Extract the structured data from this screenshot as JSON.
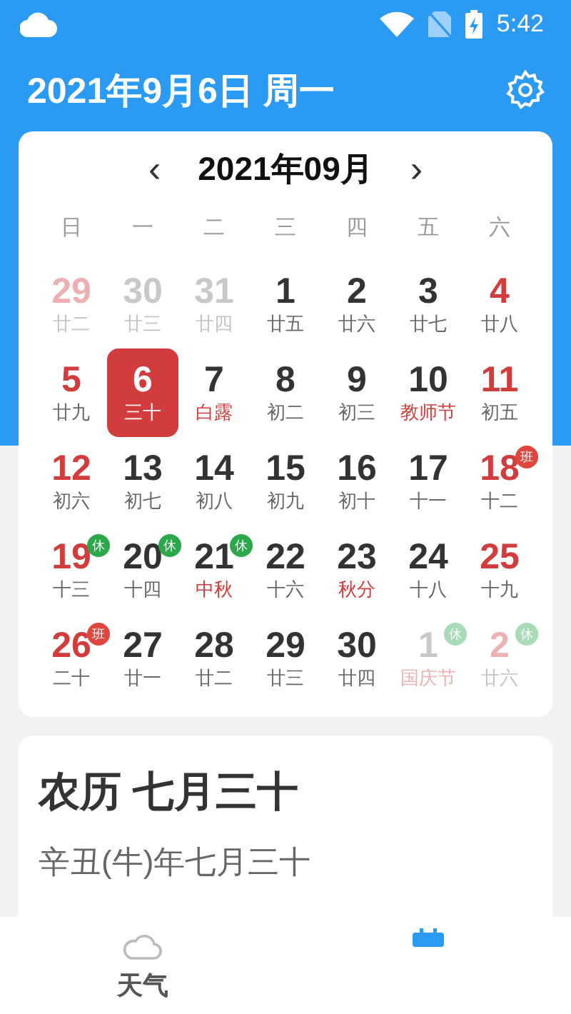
{
  "status_bar": {
    "time": "5:42"
  },
  "header": {
    "title": "2021年9月6日 周一"
  },
  "calendar": {
    "month": "2021年09月",
    "prev": "‹",
    "next": "›",
    "weekdays": [
      "日",
      "一",
      "二",
      "三",
      "四",
      "五",
      "六"
    ],
    "days": [
      {
        "day": "29",
        "lunar": "廿二",
        "muted": true,
        "weekend": true,
        "festival": false,
        "selected": false
      },
      {
        "day": "30",
        "lunar": "廿三",
        "muted": true,
        "weekend": false,
        "festival": false,
        "selected": false
      },
      {
        "day": "31",
        "lunar": "廿四",
        "muted": true,
        "weekend": false,
        "festival": false,
        "selected": false
      },
      {
        "day": "1",
        "lunar": "廿五",
        "muted": false,
        "weekend": false,
        "festival": false,
        "selected": false
      },
      {
        "day": "2",
        "lunar": "廿六",
        "muted": false,
        "weekend": false,
        "festival": false,
        "selected": false
      },
      {
        "day": "3",
        "lunar": "廿七",
        "muted": false,
        "weekend": false,
        "festival": false,
        "selected": false
      },
      {
        "day": "4",
        "lunar": "廿八",
        "muted": false,
        "weekend": true,
        "festival": false,
        "selected": false
      },
      {
        "day": "5",
        "lunar": "廿九",
        "muted": false,
        "weekend": true,
        "festival": false,
        "selected": false
      },
      {
        "day": "6",
        "lunar": "三十",
        "muted": false,
        "weekend": false,
        "festival": false,
        "selected": true
      },
      {
        "day": "7",
        "lunar": "白露",
        "muted": false,
        "weekend": false,
        "festival": true,
        "selected": false
      },
      {
        "day": "8",
        "lunar": "初二",
        "muted": false,
        "weekend": false,
        "festival": false,
        "selected": false
      },
      {
        "day": "9",
        "lunar": "初三",
        "muted": false,
        "weekend": false,
        "festival": false,
        "selected": false
      },
      {
        "day": "10",
        "lunar": "教师节",
        "muted": false,
        "weekend": false,
        "festival": true,
        "selected": false
      },
      {
        "day": "11",
        "lunar": "初五",
        "muted": false,
        "weekend": true,
        "festival": false,
        "selected": false
      },
      {
        "day": "12",
        "lunar": "初六",
        "muted": false,
        "weekend": true,
        "festival": false,
        "selected": false
      },
      {
        "day": "13",
        "lunar": "初七",
        "muted": false,
        "weekend": false,
        "festival": false,
        "selected": false
      },
      {
        "day": "14",
        "lunar": "初八",
        "muted": false,
        "weekend": false,
        "festival": false,
        "selected": false
      },
      {
        "day": "15",
        "lunar": "初九",
        "muted": false,
        "weekend": false,
        "festival": false,
        "selected": false
      },
      {
        "day": "16",
        "lunar": "初十",
        "muted": false,
        "weekend": false,
        "festival": false,
        "selected": false
      },
      {
        "day": "17",
        "lunar": "十一",
        "muted": false,
        "weekend": false,
        "festival": false,
        "selected": false
      },
      {
        "day": "18",
        "lunar": "十二",
        "muted": false,
        "weekend": true,
        "festival": false,
        "selected": false,
        "badge": {
          "text": "班",
          "kind": "work"
        }
      },
      {
        "day": "19",
        "lunar": "十三",
        "muted": false,
        "weekend": true,
        "festival": false,
        "selected": false,
        "badge": {
          "text": "休",
          "kind": "rest"
        }
      },
      {
        "day": "20",
        "lunar": "十四",
        "muted": false,
        "weekend": false,
        "festival": false,
        "selected": false,
        "badge": {
          "text": "休",
          "kind": "rest"
        }
      },
      {
        "day": "21",
        "lunar": "中秋",
        "muted": false,
        "weekend": false,
        "festival": true,
        "selected": false,
        "badge": {
          "text": "休",
          "kind": "rest"
        }
      },
      {
        "day": "22",
        "lunar": "十六",
        "muted": false,
        "weekend": false,
        "festival": false,
        "selected": false
      },
      {
        "day": "23",
        "lunar": "秋分",
        "muted": false,
        "weekend": false,
        "festival": true,
        "selected": false
      },
      {
        "day": "24",
        "lunar": "十八",
        "muted": false,
        "weekend": false,
        "festival": false,
        "selected": false
      },
      {
        "day": "25",
        "lunar": "十九",
        "muted": false,
        "weekend": true,
        "festival": false,
        "selected": false
      },
      {
        "day": "26",
        "lunar": "二十",
        "muted": false,
        "weekend": true,
        "festival": false,
        "selected": false,
        "badge": {
          "text": "班",
          "kind": "work"
        }
      },
      {
        "day": "27",
        "lunar": "廿一",
        "muted": false,
        "weekend": false,
        "festival": false,
        "selected": false
      },
      {
        "day": "28",
        "lunar": "廿二",
        "muted": false,
        "weekend": false,
        "festival": false,
        "selected": false
      },
      {
        "day": "29",
        "lunar": "廿三",
        "muted": false,
        "weekend": false,
        "festival": false,
        "selected": false
      },
      {
        "day": "30",
        "lunar": "廿四",
        "muted": false,
        "weekend": false,
        "festival": false,
        "selected": false
      },
      {
        "day": "1",
        "lunar": "国庆节",
        "muted": true,
        "weekend": false,
        "festival": true,
        "selected": false,
        "badge": {
          "text": "休",
          "kind": "rest"
        }
      },
      {
        "day": "2",
        "lunar": "廿六",
        "muted": true,
        "weekend": true,
        "festival": false,
        "selected": false,
        "badge": {
          "text": "休",
          "kind": "rest"
        }
      }
    ]
  },
  "lunar_card": {
    "title": "农历 七月三十",
    "subtitle": "辛丑(牛)年七月三十"
  },
  "bottom_nav": [
    {
      "label": "天气",
      "selected": false,
      "kind": "weather"
    },
    {
      "selected": true,
      "kind": "calendar"
    }
  ]
}
